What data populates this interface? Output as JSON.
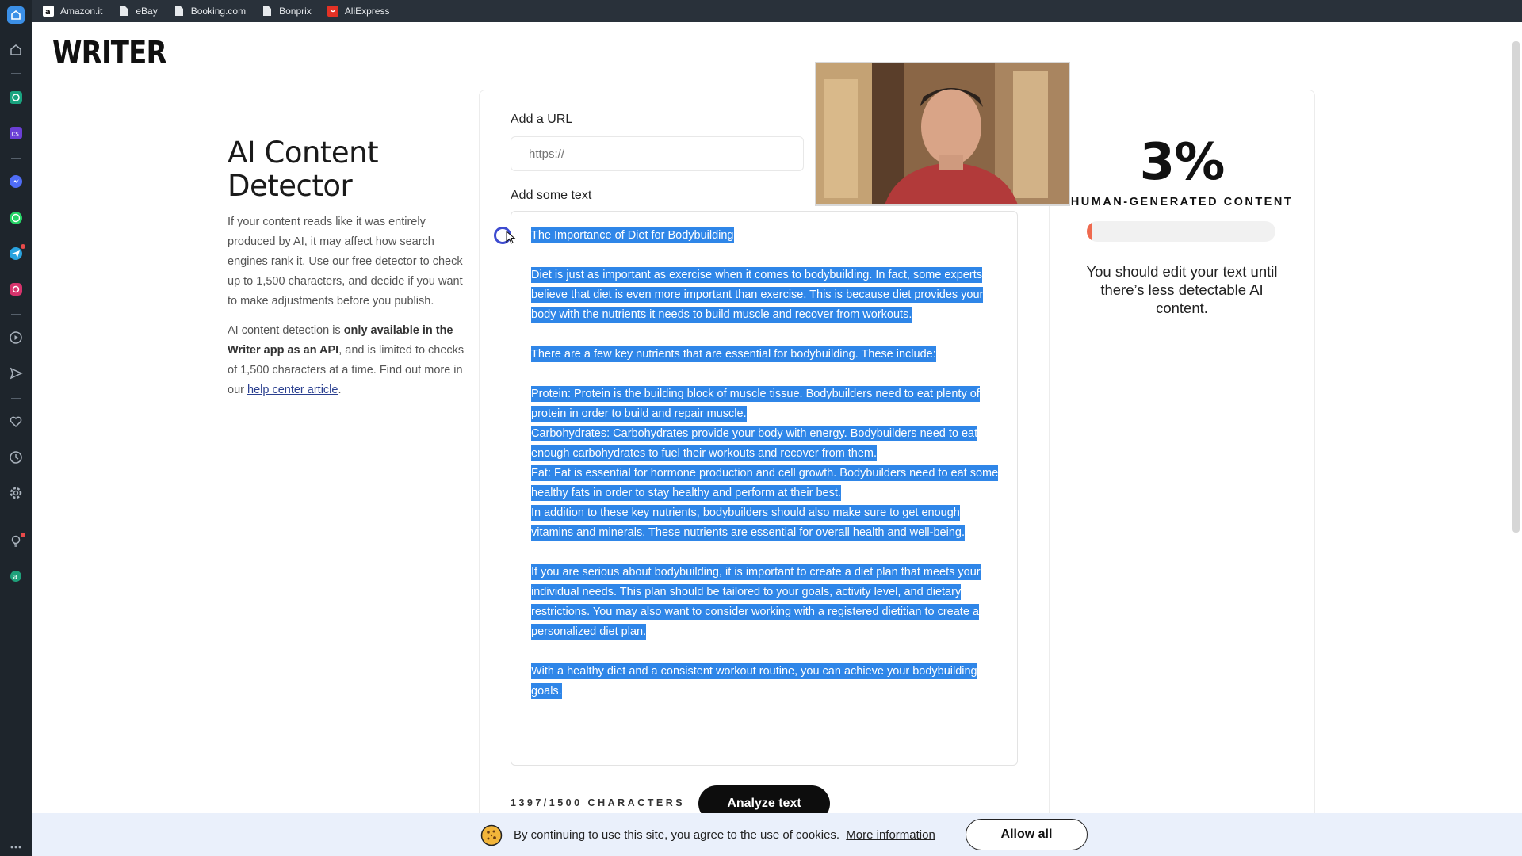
{
  "bookmarks": [
    {
      "label": "Amazon.it",
      "icon": "amazon-icon"
    },
    {
      "label": "eBay",
      "icon": "page-icon"
    },
    {
      "label": "Booking.com",
      "icon": "page-icon"
    },
    {
      "label": "Bonprix",
      "icon": "page-icon"
    },
    {
      "label": "AliExpress",
      "icon": "aliexpress-icon"
    }
  ],
  "logo": "WRITER",
  "intro": {
    "title": "AI Content Detector",
    "para1": "If your content reads like it was entirely produced by AI, it may affect how search engines rank it. Use our free detector to check up to 1,500 characters, and decide if you want to make adjustments before you publish.",
    "para2_prefix": "AI content detection is ",
    "para2_bold": "only available in the Writer app as an API",
    "para2_suffix": ", and is limited to checks of 1,500 characters at a time. Find out more in our ",
    "para2_link": "help center article",
    "para2_end": "."
  },
  "url_field": {
    "label": "Add a URL",
    "placeholder": "https://"
  },
  "text_field": {
    "label": "Add some text",
    "title_line": "The Importance of Diet for Bodybuilding",
    "p1": "Diet is just as important as exercise when it comes to bodybuilding. In fact, some experts believe that diet is even more important than exercise. This is because diet provides your body with the nutrients it needs to build muscle and recover from workouts.",
    "p2": "There are a few key nutrients that are essential for bodybuilding. These include:",
    "p3a": "Protein: Protein is the building block of muscle tissue. Bodybuilders need to eat plenty of protein in order to build and repair muscle.",
    "p3b": "Carbohydrates: Carbohydrates provide your body with energy. Bodybuilders need to eat enough carbohydrates to fuel their workouts and recover from them.",
    "p3c": "Fat: Fat is essential for hormone production and cell growth. Bodybuilders need to eat some healthy fats in order to stay healthy and perform at their best.",
    "p3d": "In addition to these key nutrients, bodybuilders should also make sure to get enough vitamins and minerals. These nutrients are essential for overall health and well-being.",
    "p4": "If you are serious about bodybuilding, it is important to create a diet plan that meets your individual needs. This plan should be tailored to your goals, activity level, and dietary restrictions. You may also want to consider working with a registered dietitian to create a personalized diet plan.",
    "p5": "With a healthy diet and a consistent workout routine, you can achieve your bodybuilding goals."
  },
  "char_count": "1397/1500 CHARACTERS",
  "analyze_button": "Analyze text",
  "result": {
    "score": "3%",
    "score_value": 0.03,
    "label": "HUMAN-GENERATED CONTENT",
    "advice": "You should edit your text until there’s less detectable AI content."
  },
  "cookie": {
    "text": "By continuing to use this site, you agree to the use of cookies.",
    "link": "More information",
    "button": "Allow all"
  },
  "colors": {
    "selection": "#2f86e8",
    "progress_fill": "#ef6a4f",
    "cookie_bar": "#eaf0fb",
    "sidebar": "#1e252c"
  }
}
